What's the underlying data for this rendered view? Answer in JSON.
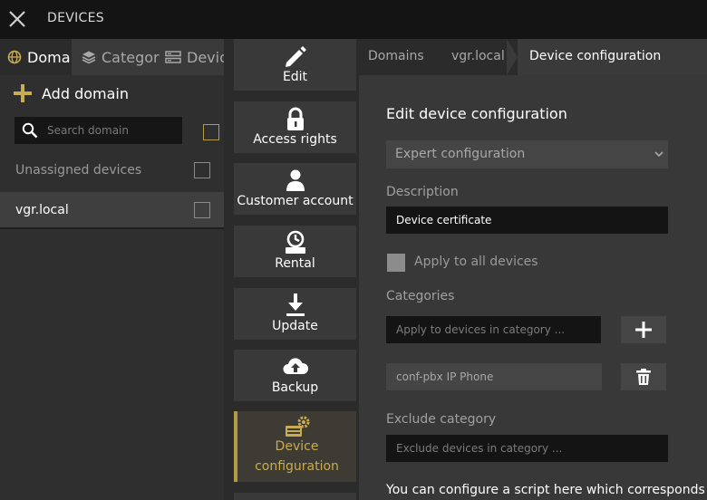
{
  "app": {
    "title": "DEVICES"
  },
  "left_tabs": [
    {
      "label": "Domains",
      "icon": "globe-icon"
    },
    {
      "label": "Categories",
      "icon": "layers-icon"
    },
    {
      "label": "Devices",
      "icon": "server-icon"
    }
  ],
  "domains": {
    "add_label": "Add domain",
    "search_placeholder": "Search domain",
    "items": [
      {
        "label": "Unassigned devices",
        "selected": false
      },
      {
        "label": "vgr.local",
        "selected": true
      }
    ]
  },
  "actions": [
    {
      "label": "Edit",
      "icon": "pencil-icon"
    },
    {
      "label": "Access rights",
      "icon": "lock-icon"
    },
    {
      "label": "Customer account",
      "icon": "user-icon"
    },
    {
      "label": "Rental",
      "icon": "rental-icon"
    },
    {
      "label": "Update",
      "icon": "download-icon"
    },
    {
      "label": "Backup",
      "icon": "cloud-upload-icon"
    },
    {
      "label_line1": "Device",
      "label_line2": "configuration",
      "icon": "device-config-icon",
      "active": true
    }
  ],
  "breadcrumb": [
    "Domains",
    "vgr.local",
    "Device configuration"
  ],
  "form": {
    "heading": "Edit device configuration",
    "config_type": "Expert configuration",
    "description_label": "Description",
    "description_value": "Device certificate",
    "apply_all_label": "Apply to all devices",
    "categories_label": "Categories",
    "categories_placeholder": "Apply to devices in category ...",
    "category_item": "conf-pbx IP Phone",
    "exclude_label": "Exclude category",
    "exclude_placeholder": "Exclude devices in category ...",
    "info_text": "You can configure a script here which corresponds to"
  },
  "colors": {
    "accent": "#b49a42",
    "background": "#2b2b2b",
    "topbar": "#141414"
  }
}
